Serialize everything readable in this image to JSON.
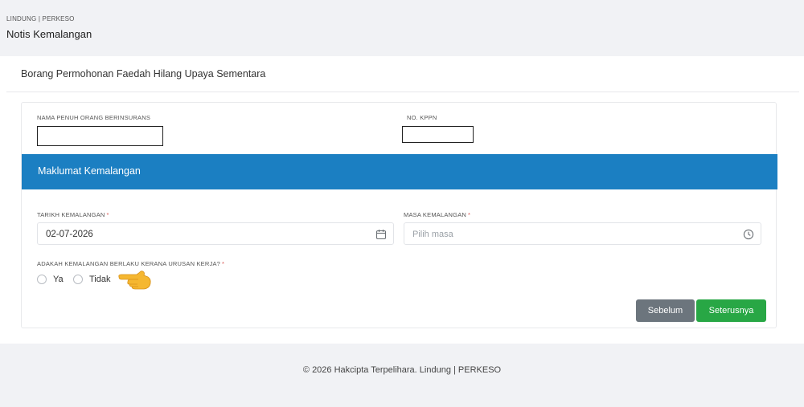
{
  "header": {
    "breadcrumb": "LINDUNG | PERKESO",
    "title": "Notis Kemalangan"
  },
  "form": {
    "title": "Borang Permohonan Faedah Hilang Upaya Sementara",
    "insured": {
      "name_label": "NAMA PENUH ORANG BERINSURANS",
      "kppn_label": "NO. KPPN"
    },
    "section": {
      "title": "Maklumat Kemalangan",
      "date_label": "TARIKH KEMALANGAN",
      "date_value": "02-07-2026",
      "time_label": "MASA KEMALANGAN",
      "time_placeholder": "Pilih masa",
      "required_mark": "*",
      "question_label": "ADAKAH KEMALANGAN BERLAKU KERANA URUSAN KERJA?",
      "options": [
        {
          "label": "Ya",
          "selected": false
        },
        {
          "label": "Tidak",
          "selected": false
        }
      ]
    },
    "buttons": {
      "previous": "Sebelum",
      "next": "Seterusnya"
    }
  },
  "footer": {
    "text": "© 2026 Hakcipta Terpelihara. Lindung | PERKESO"
  },
  "colors": {
    "banner": "#1b7fc2",
    "next_button": "#28a745",
    "previous_button": "#6c757d",
    "required": "#d9534f"
  },
  "icons": {
    "date": "calendar-icon",
    "time": "clock-icon",
    "pointer": "pointing-hand-icon"
  }
}
